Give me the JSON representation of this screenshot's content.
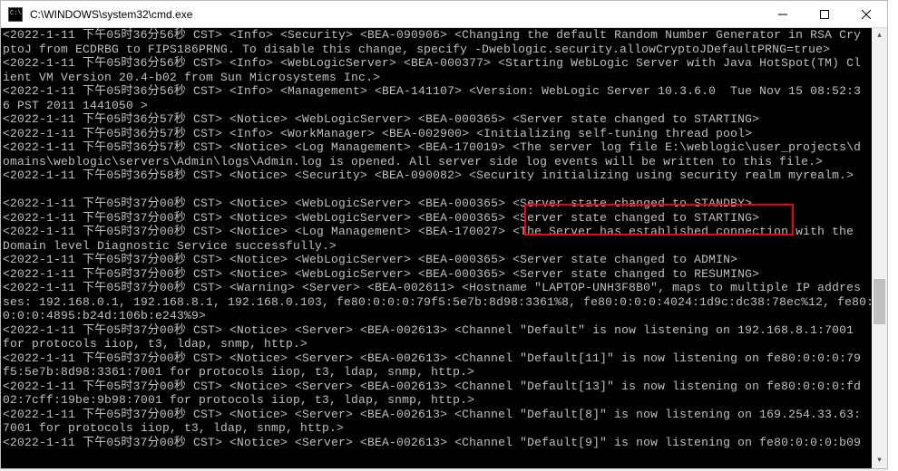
{
  "window": {
    "title": "C:\\WINDOWS\\system32\\cmd.exe",
    "icon": "cmd-icon"
  },
  "controls": {
    "minimize": "─",
    "maximize": "□",
    "close": "✕"
  },
  "terminal": {
    "lines": [
      "<2022-1-11 下午05时36分56秒 CST> <Info> <Security> <BEA-090906> <Changing the default Random Number Generator in RSA Cry",
      "ptoJ from ECDRBG to FIPS186PRNG. To disable this change, specify -Dweblogic.security.allowCryptoJDefaultPRNG=true>",
      "<2022-1-11 下午05时36分56秒 CST> <Info> <WebLogicServer> <BEA-000377> <Starting WebLogic Server with Java HotSpot(TM) Cl",
      "ient VM Version 20.4-b02 from Sun Microsystems Inc.>",
      "<2022-1-11 下午05时36分56秒 CST> <Info> <Management> <BEA-141107> <Version: WebLogic Server 10.3.6.0  Tue Nov 15 08:52:3",
      "6 PST 2011 1441050 >",
      "<2022-1-11 下午05时36分57秒 CST> <Notice> <WebLogicServer> <BEA-000365> <Server state changed to STARTING>",
      "<2022-1-11 下午05时36分57秒 CST> <Info> <WorkManager> <BEA-002900> <Initializing self-tuning thread pool>",
      "<2022-1-11 下午05时36分57秒 CST> <Notice> <Log Management> <BEA-170019> <The server log file E:\\weblogic\\user_projects\\d",
      "omains\\weblogic\\servers\\Admin\\logs\\Admin.log is opened. All server side log events will be written to this file.>",
      "<2022-1-11 下午05时36分58秒 CST> <Notice> <Security> <BEA-090082> <Security initializing using security realm myrealm.>",
      "",
      "<2022-1-11 下午05时37分00秒 CST> <Notice> <WebLogicServer> <BEA-000365> <Server state changed to STANDBY>",
      "<2022-1-11 下午05时37分00秒 CST> <Notice> <WebLogicServer> <BEA-000365> <Server state changed to STARTING>",
      "<2022-1-11 下午05时37分00秒 CST> <Notice> <Log Management> <BEA-170027> <The Server has established connection with the",
      "Domain level Diagnostic Service successfully.>",
      "<2022-1-11 下午05时37分00秒 CST> <Notice> <WebLogicServer> <BEA-000365> <Server state changed to ADMIN>",
      "<2022-1-11 下午05时37分00秒 CST> <Notice> <WebLogicServer> <BEA-000365> <Server state changed to RESUMING>",
      "<2022-1-11 下午05时37分00秒 CST> <Warning> <Server> <BEA-002611> <Hostname \"LAPTOP-UNH3F8B0\", maps to multiple IP addres",
      "ses: 192.168.0.1, 192.168.8.1, 192.168.0.103, fe80:0:0:0:79f5:5e7b:8d98:3361%8, fe80:0:0:0:4024:1d9c:dc38:78ec%12, fe80:",
      "0:0:0:4895:b24d:106b:e243%9>",
      "<2022-1-11 下午05时37分00秒 CST> <Notice> <Server> <BEA-002613> <Channel \"Default\" is now listening on 192.168.8.1:7001",
      "for protocols iiop, t3, ldap, snmp, http.>",
      "<2022-1-11 下午05时37分00秒 CST> <Notice> <Server> <BEA-002613> <Channel \"Default[11]\" is now listening on fe80:0:0:0:79",
      "f5:5e7b:8d98:3361:7001 for protocols iiop, t3, ldap, snmp, http.>",
      "<2022-1-11 下午05时37分00秒 CST> <Notice> <Server> <BEA-002613> <Channel \"Default[13]\" is now listening on fe80:0:0:0:fd",
      "02:7cff:19be:9b98:7001 for protocols iiop, t3, ldap, snmp, http.>",
      "<2022-1-11 下午05时37分00秒 CST> <Notice> <Server> <BEA-002613> <Channel \"Default[8]\" is now listening on 169.254.33.63:",
      "7001 for protocols iiop, t3, ldap, snmp, http.>",
      "<2022-1-11 下午05时37分00秒 CST> <Notice> <Server> <BEA-002613> <Channel \"Default[9]\" is now listening on fe80:0:0:0:b09"
    ]
  },
  "highlight": {
    "line1": "<Server state changed to STANDBY>",
    "line2": "<Server state changed to STARTING>"
  }
}
